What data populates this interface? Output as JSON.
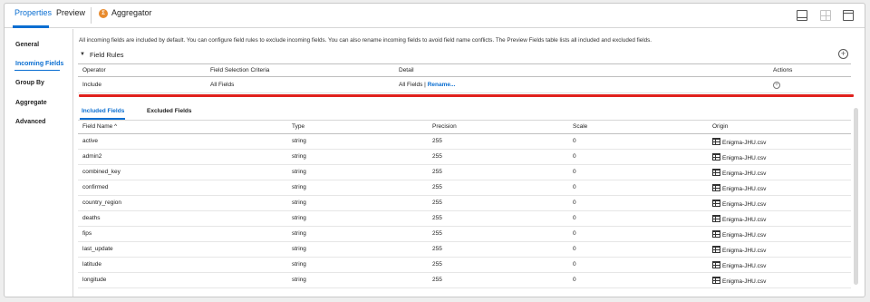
{
  "tabs": {
    "properties": "Properties",
    "preview": "Preview",
    "aggregator": "Aggregator"
  },
  "sidebar": {
    "items": [
      {
        "label": "General"
      },
      {
        "label": "Incoming Fields",
        "active": true
      },
      {
        "label": "Group By"
      },
      {
        "label": "Aggregate"
      },
      {
        "label": "Advanced"
      }
    ]
  },
  "main": {
    "description": "All incoming fields are included by default. You can configure field rules to exclude incoming fields. You can also rename incoming fields to avoid field name conflicts. The Preview Fields table lists all included and excluded fields.",
    "field_rules_title": "Field Rules",
    "rules_headers": {
      "operator": "Operator",
      "criteria": "Field Selection Criteria",
      "detail": "Detail",
      "actions": "Actions"
    },
    "rules": [
      {
        "operator": "Include",
        "criteria": "All Fields",
        "detail": "All Fields",
        "detail_sep": " | ",
        "rename": "Rename..."
      }
    ]
  },
  "field_tabs": {
    "included": "Included Fields",
    "excluded": "Excluded Fields"
  },
  "grid": {
    "headers": {
      "name": "Field Name ^",
      "type": "Type",
      "precision": "Precision",
      "scale": "Scale",
      "origin": "Origin"
    },
    "rows": [
      {
        "name": "active",
        "type": "string",
        "precision": "255",
        "scale": "0",
        "origin": "Enigma-JHU.csv"
      },
      {
        "name": "admin2",
        "type": "string",
        "precision": "255",
        "scale": "0",
        "origin": "Enigma-JHU.csv"
      },
      {
        "name": "combined_key",
        "type": "string",
        "precision": "255",
        "scale": "0",
        "origin": "Enigma-JHU.csv"
      },
      {
        "name": "confirmed",
        "type": "string",
        "precision": "255",
        "scale": "0",
        "origin": "Enigma-JHU.csv"
      },
      {
        "name": "country_region",
        "type": "string",
        "precision": "255",
        "scale": "0",
        "origin": "Enigma-JHU.csv"
      },
      {
        "name": "deaths",
        "type": "string",
        "precision": "255",
        "scale": "0",
        "origin": "Enigma-JHU.csv"
      },
      {
        "name": "fips",
        "type": "string",
        "precision": "255",
        "scale": "0",
        "origin": "Enigma-JHU.csv"
      },
      {
        "name": "last_update",
        "type": "string",
        "precision": "255",
        "scale": "0",
        "origin": "Enigma-JHU.csv"
      },
      {
        "name": "latitude",
        "type": "string",
        "precision": "255",
        "scale": "0",
        "origin": "Enigma-JHU.csv"
      },
      {
        "name": "longitude",
        "type": "string",
        "precision": "255",
        "scale": "0",
        "origin": "Enigma-JHU.csv"
      }
    ]
  },
  "colors": {
    "accent": "#0a6ed1",
    "highlight": "#e0211d",
    "aggregator_icon": "#e88b2e"
  },
  "icons": {
    "aggregator": "aggregator-icon",
    "add": "add-circle-icon",
    "action": "action-circle-icon",
    "origin": "table-icon"
  }
}
